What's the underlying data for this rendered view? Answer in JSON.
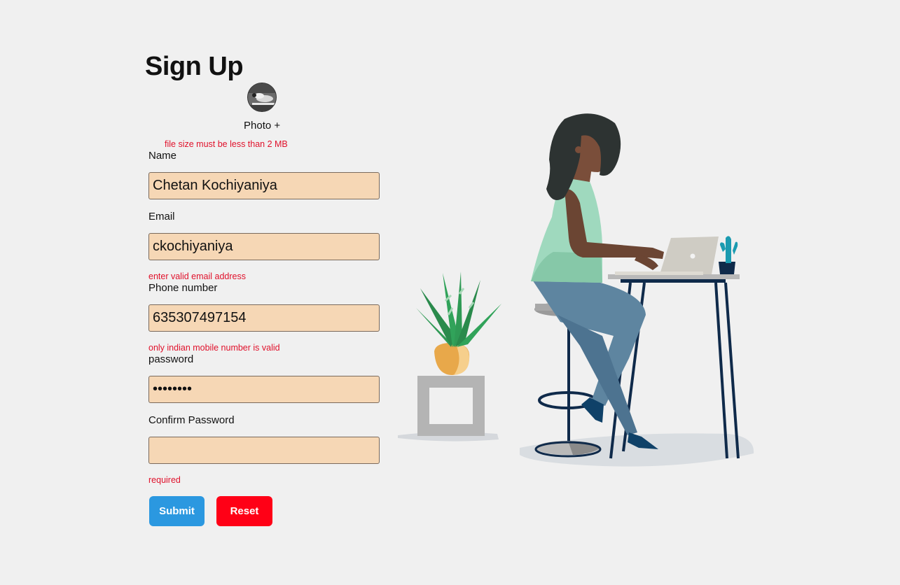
{
  "form": {
    "title": "Sign Up",
    "photo_label": "Photo +",
    "photo_error": "file size must be less than 2 MB",
    "name": {
      "label": "Name",
      "value": "Chetan Kochiyaniya"
    },
    "email": {
      "label": "Email",
      "value": "ckochiyaniya",
      "error": "enter valid email address"
    },
    "phone": {
      "label": "Phone number",
      "value": "635307497154",
      "error": "only indian mobile number is valid"
    },
    "password": {
      "label": "password",
      "value": "password"
    },
    "confirm_password": {
      "label": "Confirm Password",
      "value": "",
      "error": "required"
    },
    "submit_label": "Submit",
    "reset_label": "Reset"
  },
  "colors": {
    "background": "#f0f0f0",
    "field_background": "#f6d7b5",
    "error": "#e0112b",
    "submit": "#2b98e0",
    "reset": "#ff0016"
  }
}
